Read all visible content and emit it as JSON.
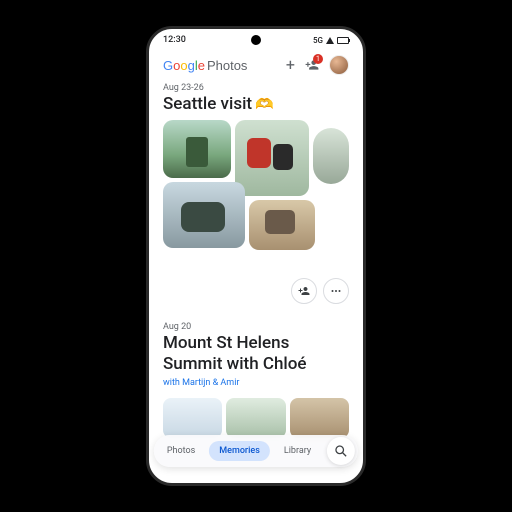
{
  "status": {
    "time": "12:30",
    "network": "5G"
  },
  "app": {
    "logo_main": "Google",
    "logo_sub": "Photos",
    "share_badge": "1"
  },
  "memory1": {
    "date": "Aug 23-26",
    "title": "Seattle visit",
    "emoji": "🫶"
  },
  "memory2": {
    "date": "Aug 20",
    "title_line1": "Mount St Helens",
    "title_line2": "Summit with Chloé",
    "subtitle": "with Martijn & Amir"
  },
  "nav": {
    "photos": "Photos",
    "memories": "Memories",
    "library": "Library"
  }
}
